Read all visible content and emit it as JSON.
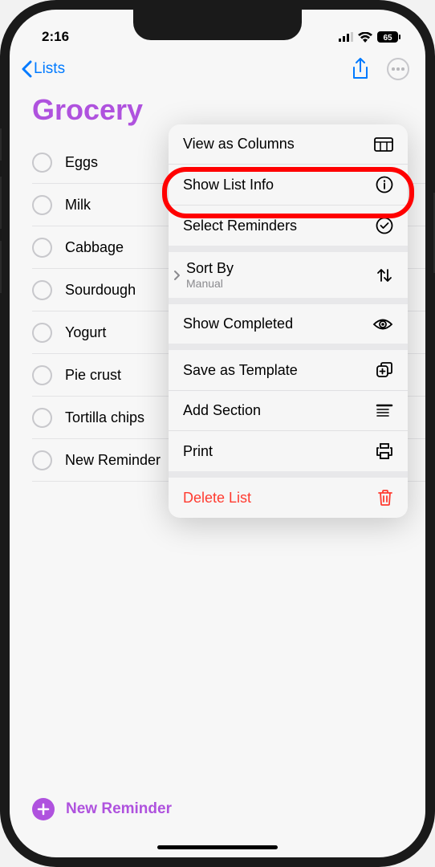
{
  "status": {
    "time": "2:16",
    "battery": "65"
  },
  "nav": {
    "back_label": "Lists"
  },
  "list": {
    "title": "Grocery",
    "accent": "#af52de"
  },
  "reminders": [
    {
      "text": "Eggs"
    },
    {
      "text": "Milk"
    },
    {
      "text": "Cabbage"
    },
    {
      "text": "Sourdough"
    },
    {
      "text": "Yogurt"
    },
    {
      "text": "Pie crust"
    },
    {
      "text": "Tortilla chips"
    },
    {
      "text": "New Reminder"
    }
  ],
  "new_reminder": {
    "label": "New Reminder"
  },
  "menu": {
    "view_columns": "View as Columns",
    "show_list_info": "Show List Info",
    "select_reminders": "Select Reminders",
    "sort_by": "Sort By",
    "sort_by_value": "Manual",
    "show_completed": "Show Completed",
    "save_template": "Save as Template",
    "add_section": "Add Section",
    "print": "Print",
    "delete_list": "Delete List"
  }
}
